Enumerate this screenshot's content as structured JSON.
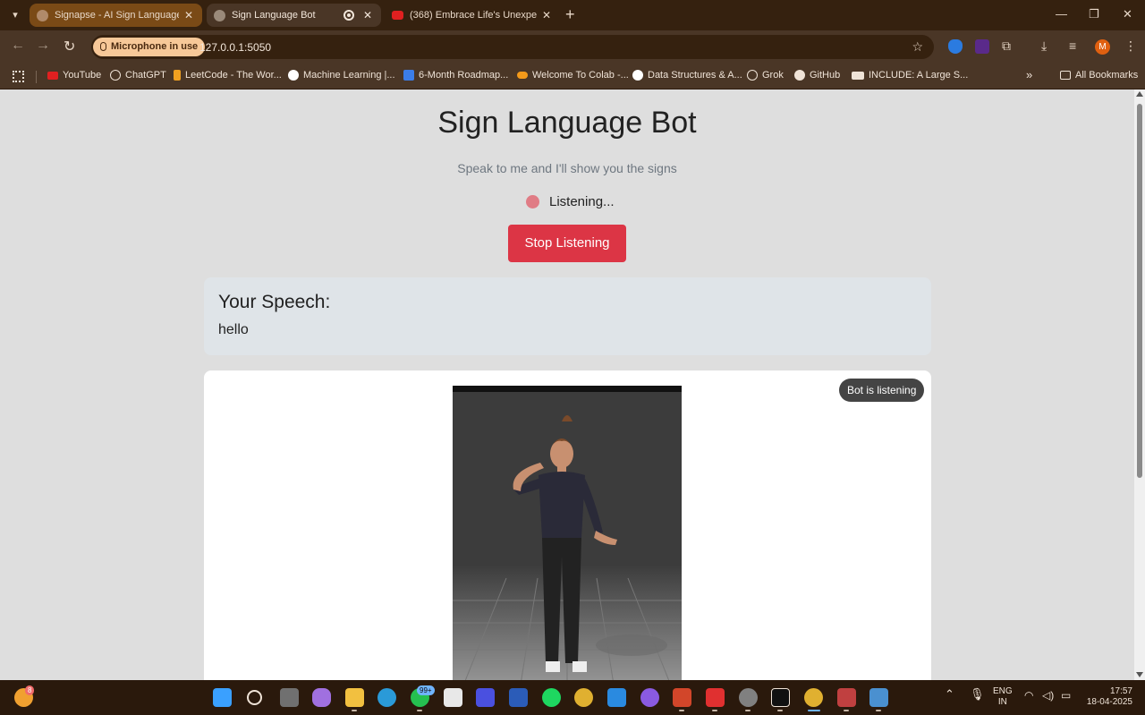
{
  "browser": {
    "tabs": [
      {
        "title": "Signapse - AI Sign Language Tr",
        "active": false
      },
      {
        "title": "Sign Language Bot",
        "active": true
      },
      {
        "title": "(368) Embrace Life's Unexpecte",
        "active": false
      }
    ],
    "mic_indicator": "Microphone in use",
    "url": "127.0.0.1:5050",
    "avatar_letter": "M",
    "bookmarks": [
      "YouTube",
      "ChatGPT",
      "LeetCode - The Wor...",
      "Machine Learning |...",
      "6-Month Roadmap...",
      "Welcome To Colab -...",
      "Data Structures & A...",
      "Grok",
      "GitHub",
      "INCLUDE: A Large S..."
    ],
    "all_bookmarks": "All Bookmarks",
    "more_bookmarks": "»"
  },
  "page": {
    "title": "Sign Language Bot",
    "subtitle": "Speak to me and I'll show you the signs",
    "status": "Listening...",
    "stop_button": "Stop Listening",
    "speech_label": "Your Speech:",
    "speech_text": "hello",
    "bot_badge": "Bot is listening"
  },
  "taskbar": {
    "weather_badge": "8",
    "whatsapp_badge": "99+",
    "language": "ENG",
    "region": "IN",
    "time": "17:57",
    "date": "18-04-2025"
  },
  "colors": {
    "stop_button": "#dc3545",
    "status_dot": "#e07c85",
    "browser_frame": "#35210f"
  }
}
